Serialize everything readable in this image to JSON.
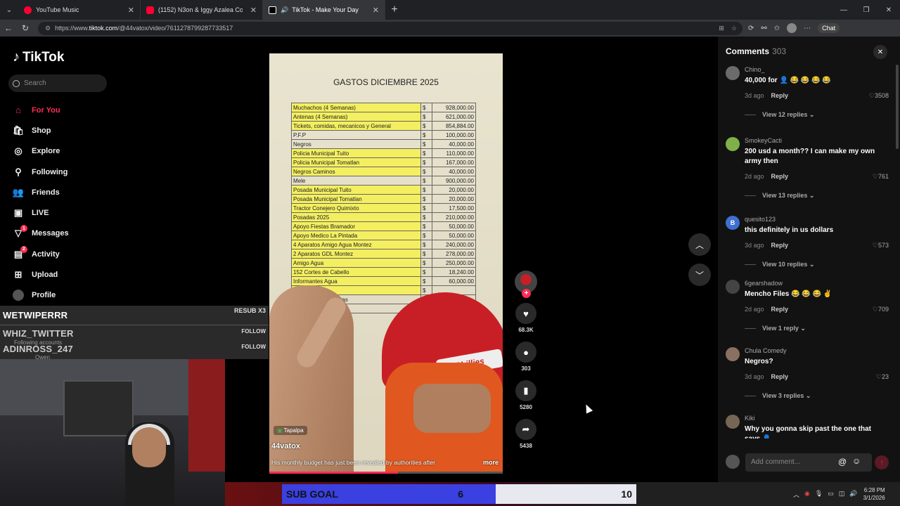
{
  "browser": {
    "tabs": [
      {
        "title": "YouTube Music",
        "color": "#ff0033"
      },
      {
        "title": "(1152) N3on & Iggy Azalea Cook S",
        "color": "#ff0033"
      },
      {
        "title": "TikTok - Make Your Day",
        "color": "#000000"
      }
    ],
    "url_prefix": "https://www.",
    "url_host": "tiktok.com",
    "url_path": "/@44vatox/video/7611278799287733517",
    "chat_label": "Chat"
  },
  "sidebar": {
    "brand": "TikTok",
    "search_placeholder": "Search",
    "items": [
      {
        "label": "For You",
        "icon": "home-icon"
      },
      {
        "label": "Shop",
        "icon": "shop-icon"
      },
      {
        "label": "Explore",
        "icon": "compass-icon"
      },
      {
        "label": "Following",
        "icon": "following-icon"
      },
      {
        "label": "Friends",
        "icon": "friends-icon"
      },
      {
        "label": "LIVE",
        "icon": "live-icon"
      },
      {
        "label": "Messages",
        "icon": "messages-icon",
        "badge": "1"
      },
      {
        "label": "Activity",
        "icon": "activity-icon",
        "badge": "2"
      },
      {
        "label": "Upload",
        "icon": "upload-icon"
      },
      {
        "label": "Profile",
        "icon": "profile-icon"
      }
    ]
  },
  "overlay": {
    "title": "WETWIPERRR",
    "resub": "RESUB X3",
    "follow1": "WHIZ_TWITTER",
    "follow1_tag": "FOLLOW",
    "sub1": "Following accounts",
    "follow2": "ADINROSS_247",
    "follow2_tag": "FOLLOW",
    "sub2": "Owen"
  },
  "video": {
    "paper_title": "GASTOS DICIEMBRE 2025",
    "rows": [
      {
        "item": "Muchachos (4 Semanas)",
        "amount": "928,000.00"
      },
      {
        "item": "Antenas (4 Semanas)",
        "amount": "621,000.00"
      },
      {
        "item": "Tickets, comidas, mecanicos y General",
        "amount": "854,884.00"
      },
      {
        "item": "P.F.P",
        "amount": "100,000.00"
      },
      {
        "item": "Negros",
        "amount": "40,000.00"
      },
      {
        "item": "Policia Municipal Tuito",
        "amount": "110,000.00"
      },
      {
        "item": "Policia Municipal Tomatlan",
        "amount": "167,000.00"
      },
      {
        "item": "Negros Caminos",
        "amount": "40,000.00"
      },
      {
        "item": "Mele",
        "amount": "900,000.00"
      },
      {
        "item": "Posada Municipal Tuito",
        "amount": "20,000.00"
      },
      {
        "item": "Posada Municipal Tomatlan",
        "amount": "20,000.00"
      },
      {
        "item": "Tractor Conejero Quimixto",
        "amount": "17,500.00"
      },
      {
        "item": "Posadas 2025",
        "amount": "210,000.00"
      },
      {
        "item": "Apoyo Fiestas Bramador",
        "amount": "50,000.00"
      },
      {
        "item": "Apoyo Medico La Pintada",
        "amount": "50,000.00"
      },
      {
        "item": "4 Aparatos Amigo Agua Montez",
        "amount": "240,000.00"
      },
      {
        "item": "2 Aparatos GDL Montez",
        "amount": "278,000.00"
      },
      {
        "item": "Amigo Agua",
        "amount": "250,000.00"
      },
      {
        "item": "152 Cortes de Cabello",
        "amount": "18,240.00"
      },
      {
        "item": "Informantes Agua",
        "amount": "60,000.00"
      },
      {
        "item": "Informantes",
        "amount": ""
      },
      {
        "item": "2100 Ca... despensas",
        "amount": ""
      },
      {
        "item": "2100 F... as Mele",
        "amount": ""
      }
    ],
    "cap_text": "Phillies",
    "location": "Tapalpa",
    "username": "44vatox",
    "description": "His monthly budget has just been revealed by authorities after",
    "more": "more",
    "progress": 0.55
  },
  "actions": {
    "likes": "68.3K",
    "comments": "303",
    "saves": "5280",
    "shares": "5438"
  },
  "comments": {
    "title": "Comments",
    "count": "303",
    "list": [
      {
        "user": "Chino_",
        "text": "40,000 for 👤 😂 😂 😂 😂",
        "time": "3d ago",
        "reply": "Reply",
        "likes": "3508",
        "replies": "View 12 replies",
        "avatar_color": "#6b6b6b"
      },
      {
        "user": "SmokeyCacti",
        "text": "200 usd a month?? I can make my own army then",
        "time": "2d ago",
        "reply": "Reply",
        "likes": "761",
        "replies": "View 13 replies",
        "avatar_color": "#7fb04a"
      },
      {
        "user": "quesito123",
        "text": "this definitely in us dollars",
        "time": "3d ago",
        "reply": "Reply",
        "likes": "573",
        "replies": "View 10 replies",
        "avatar_color": "#3f6fd0",
        "initial": "B"
      },
      {
        "user": "6gearshadow",
        "text": "Mencho Files 😂 😂 😂 ✌",
        "time": "2d ago",
        "reply": "Reply",
        "likes": "709",
        "replies": "View 1 reply",
        "avatar_color": "#444444"
      },
      {
        "user": "Chula Comedy",
        "text": "Negros?",
        "time": "3d ago",
        "reply": "Reply",
        "likes": "23",
        "replies": "View 3 replies",
        "avatar_color": "#8a7060"
      },
      {
        "user": "Kiki",
        "text": "Why you gonna skip past the one that says 👤",
        "time": "",
        "reply": "",
        "likes": "",
        "replies": "",
        "avatar_color": "#776655"
      }
    ],
    "input_placeholder": "Add comment..."
  },
  "stream": {
    "subgoal_label": "SUB GOAL",
    "subgoal_current": "6",
    "subgoal_target": "10"
  },
  "taskbar": {
    "time": "6:28 PM",
    "date": "3/1/2026"
  }
}
